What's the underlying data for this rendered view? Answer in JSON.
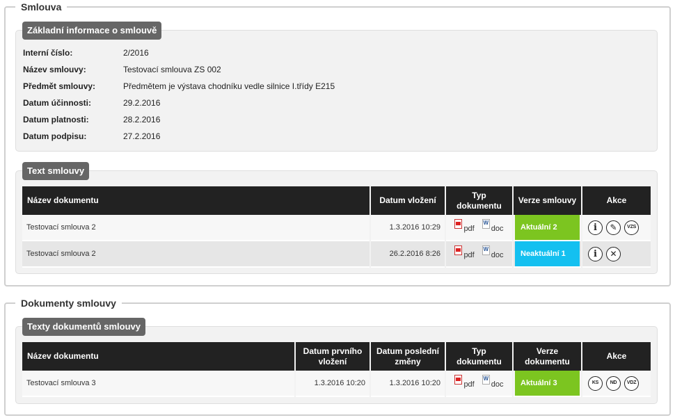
{
  "smlouva": {
    "legend": "Smlouva",
    "info": {
      "title": "Základní informace o smlouvě",
      "rows": [
        {
          "label": "Interní číslo:",
          "value": "2/2016"
        },
        {
          "label": "Název smlouvy:",
          "value": "Testovací smlouva ZS 002"
        },
        {
          "label": "Předmět smlouvy:",
          "value": "Předmětem je výstava chodníku vedle silnice I.třídy E215"
        },
        {
          "label": "Datum účinnosti:",
          "value": "29.2.2016"
        },
        {
          "label": "Datum platnosti:",
          "value": "28.2.2016"
        },
        {
          "label": "Datum podpisu:",
          "value": "27.2.2016"
        }
      ]
    },
    "text": {
      "title": "Text smlouvy",
      "headers": {
        "name": "Název dokumentu",
        "date": "Datum vložení",
        "type": "Typ dokumentu",
        "version": "Verze smlouvy",
        "actions": "Akce"
      },
      "rows": [
        {
          "name": "Testovací smlouva 2",
          "date": "1.3.2016 10:29",
          "pdf": "pdf",
          "doc": "doc",
          "version": "Aktuální 2",
          "version_color": "#7cc520"
        },
        {
          "name": "Testovací smlouva 2",
          "date": "26.2.2016 8:26",
          "pdf": "pdf",
          "doc": "doc",
          "version": "Neaktuální 1",
          "version_color": "#14c0f0"
        }
      ],
      "action_labels": {
        "vzs": "VZS"
      }
    }
  },
  "dokumenty": {
    "legend": "Dokumenty smlouvy",
    "texty": {
      "title": "Texty dokumentů smlouvy",
      "headers": {
        "name": "Název dokumentu",
        "first": "Datum prvního vložení",
        "last": "Datum poslední změny",
        "type": "Typ dokumentu",
        "version": "Verze dokumentu",
        "actions": "Akce"
      },
      "rows": [
        {
          "name": "Testovací smlouva 3",
          "first": "1.3.2016 10:20",
          "last": "1.3.2016 10:20",
          "pdf": "pdf",
          "doc": "doc",
          "version": "Aktuální 3",
          "version_color": "#7cc520"
        }
      ],
      "action_labels": {
        "ks": "KS",
        "nd": "ND",
        "vdz": "VDZ"
      }
    }
  },
  "icons": [
    "info-icon",
    "edit-icon",
    "close-icon",
    "pdf-icon",
    "word-icon"
  ]
}
